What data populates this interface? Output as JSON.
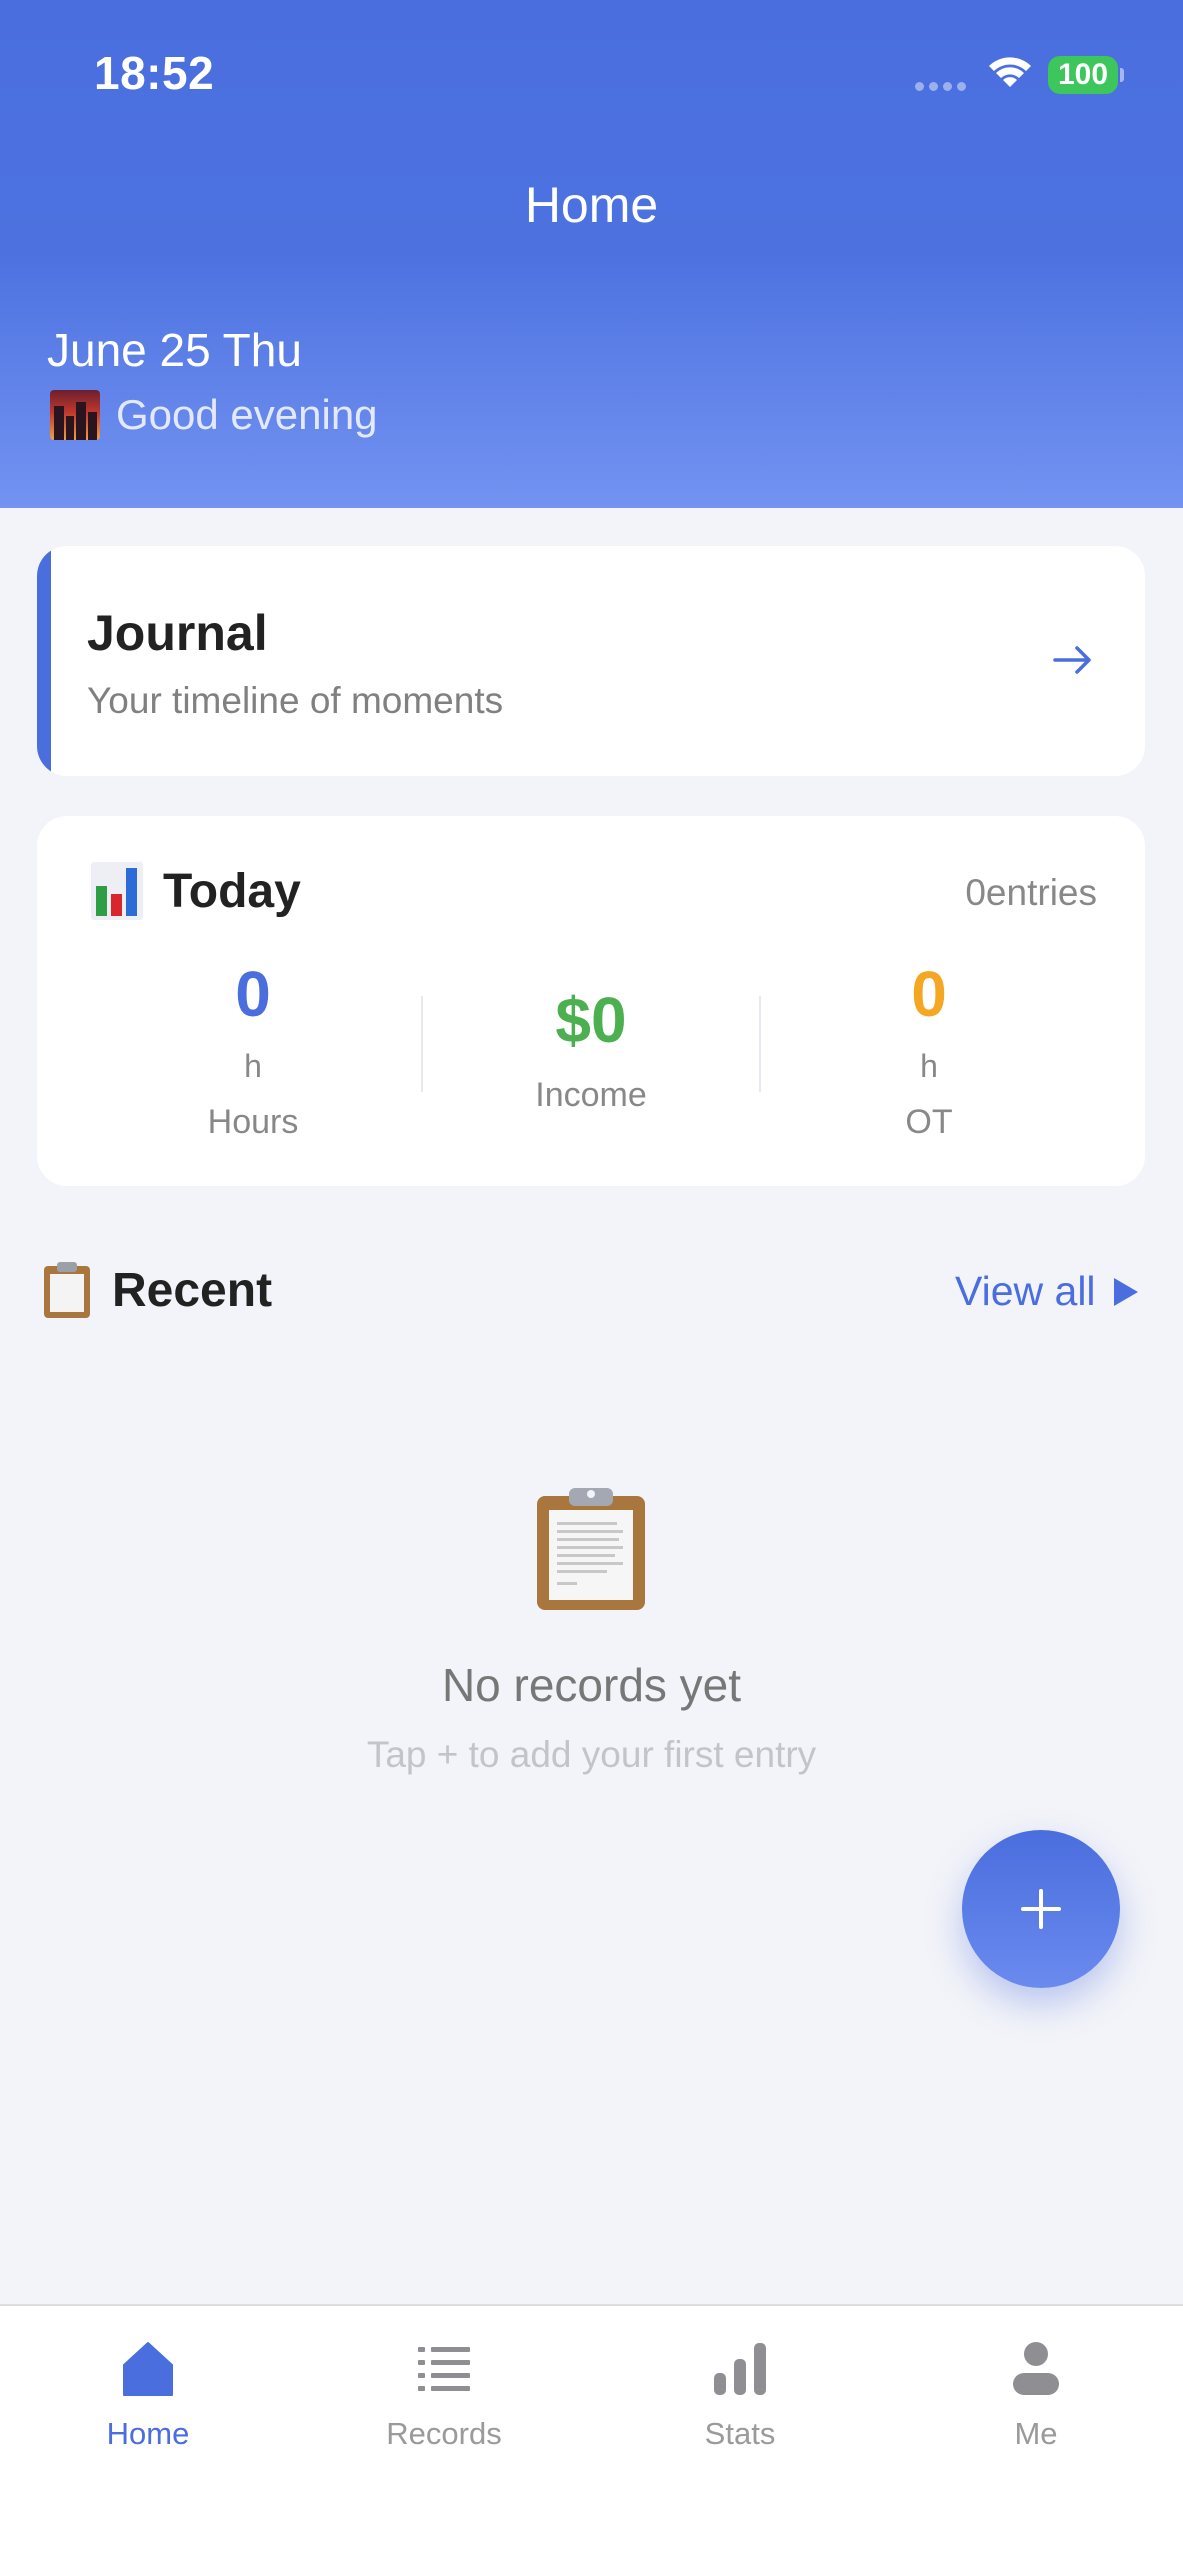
{
  "status_bar": {
    "time": "18:52",
    "battery": "100"
  },
  "header": {
    "title": "Home",
    "date": "June 25 Thu",
    "greeting": "Good evening",
    "greeting_icon": "city-sunset-icon"
  },
  "journal": {
    "title": "Journal",
    "subtitle": "Your timeline of moments"
  },
  "today": {
    "title": "Today",
    "entries": "0entries",
    "stats": [
      {
        "value": "0",
        "unit": "h",
        "label": "Hours"
      },
      {
        "value": "$0",
        "label": "Income"
      },
      {
        "value": "0",
        "unit": "h",
        "label": "OT"
      }
    ]
  },
  "recent": {
    "title": "Recent",
    "view_all": "View all",
    "empty_title": "No records yet",
    "empty_hint": "Tap + to add your first entry"
  },
  "tabs": [
    {
      "label": "Home",
      "icon": "home-icon",
      "active": true
    },
    {
      "label": "Records",
      "icon": "list-icon",
      "active": false
    },
    {
      "label": "Stats",
      "icon": "bar-chart-icon",
      "active": false
    },
    {
      "label": "Me",
      "icon": "person-icon",
      "active": false
    }
  ],
  "colors": {
    "primary": "#4A6EDE",
    "income": "#4CAF50",
    "overtime": "#F5A623",
    "background": "#F3F4F9"
  }
}
